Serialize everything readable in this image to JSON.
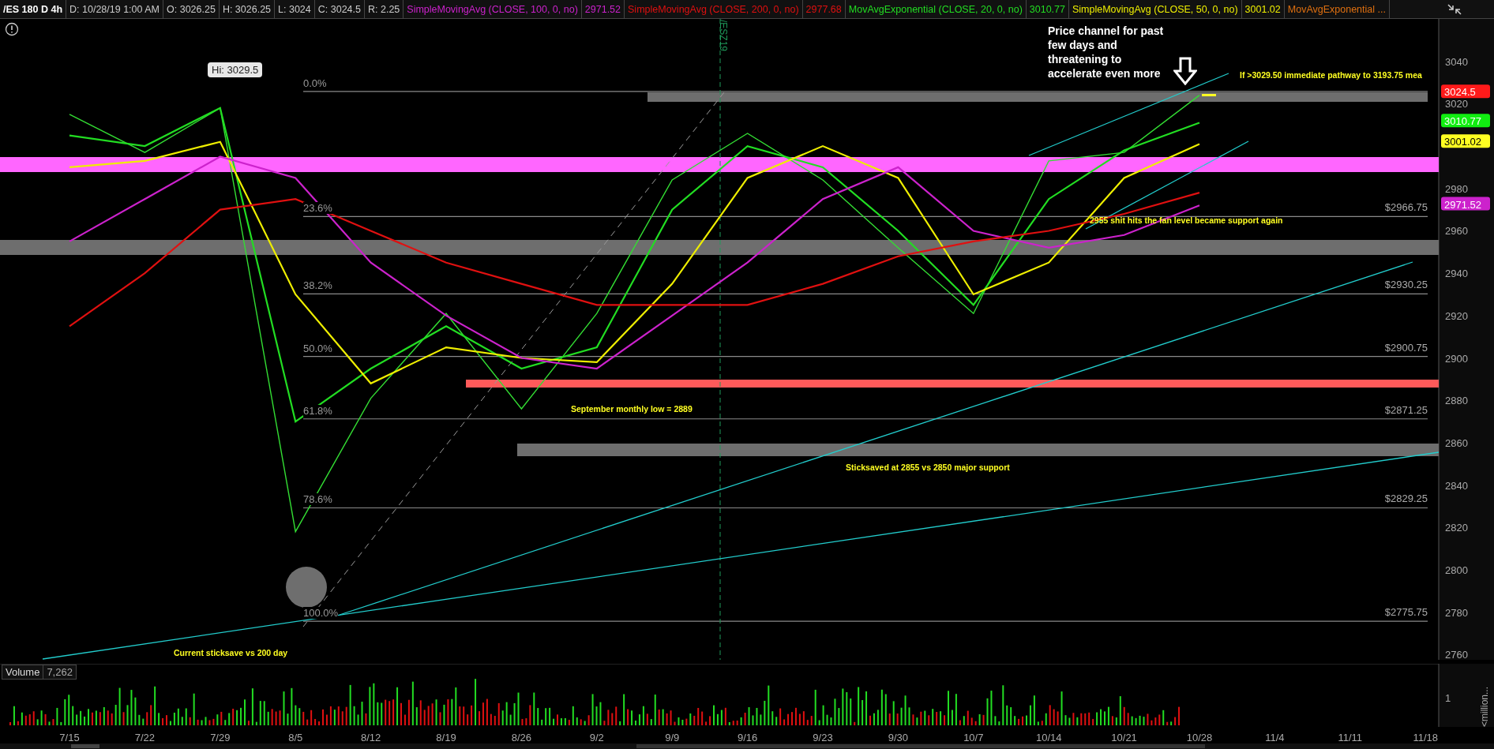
{
  "header": {
    "symbol": "/ES 180 D 4h",
    "fields": [
      "D: 10/28/19 1:00 AM",
      "O: 3026.25",
      "H: 3026.25",
      "L: 3024",
      "C: 3024.5",
      "R: 2.25"
    ],
    "studies": [
      {
        "name": "SimpleMovingAvg (CLOSE, 100, 0, no)",
        "value": "2971.52",
        "color": "#cc22cc"
      },
      {
        "name": "SimpleMovingAvg (CLOSE, 200, 0, no)",
        "value": "2977.68",
        "color": "#e01010"
      },
      {
        "name": "MovAvgExponential (CLOSE, 20, 0, no)",
        "value": "3010.77",
        "color": "#22dd22"
      },
      {
        "name": "SimpleMovingAvg (CLOSE, 50, 0, no)",
        "value": "3001.02",
        "color": "#eeee00"
      },
      {
        "name": "MovAvgExponential ...",
        "color": "#e07010"
      }
    ]
  },
  "price_chart": {
    "contract_label": "/ESZ19",
    "high_label": "Hi: 3029.5",
    "chart_data": {
      "type": "line",
      "x": [
        "7/15",
        "7/22",
        "7/29",
        "8/5",
        "8/12",
        "8/19",
        "8/26",
        "9/2",
        "9/9",
        "9/16",
        "9/23",
        "9/30",
        "10/7",
        "10/14",
        "10/21",
        "10/28",
        "11/4",
        "11/11",
        "11/18"
      ],
      "series": [
        {
          "color": "#33dd33",
          "values": [
            3015,
            2997,
            3018,
            2818,
            2881,
            2921,
            2876,
            2921,
            2984,
            3006,
            2984,
            2952,
            2921,
            2993,
            2997,
            3024,
            null,
            null,
            null
          ]
        },
        {
          "color": "#22dd22",
          "values": [
            3005,
            3000,
            3018,
            2870,
            2895,
            2915,
            2895,
            2905,
            2970,
            3000,
            2990,
            2960,
            2925,
            2975,
            2998,
            3011,
            null,
            null,
            null
          ]
        },
        {
          "color": "#eeee00",
          "values": [
            2990,
            2993,
            3002,
            2930,
            2888,
            2905,
            2900,
            2898,
            2935,
            2985,
            3000,
            2985,
            2930,
            2945,
            2985,
            3001,
            null,
            null,
            null
          ]
        },
        {
          "color": "#cc22cc",
          "values": [
            2955,
            2975,
            2995,
            2985,
            2945,
            2920,
            2900,
            2895,
            2920,
            2945,
            2975,
            2990,
            2960,
            2952,
            2958,
            2972,
            null,
            null,
            null
          ]
        },
        {
          "color": "#e01010",
          "values": [
            2915,
            2940,
            2970,
            2975,
            2960,
            2945,
            2935,
            2925,
            2925,
            2925,
            2935,
            2948,
            2955,
            2960,
            2968,
            2978,
            null,
            null,
            null
          ]
        }
      ],
      "ylim": [
        2727,
        3060
      ],
      "yticks": [
        3040,
        3020,
        2980,
        2960,
        2940,
        2920,
        2900,
        2880,
        2860,
        2840,
        2820,
        2800,
        2780,
        2760
      ]
    },
    "price_badges": [
      {
        "text": "3024.5",
        "color": "#ff1a1a"
      },
      {
        "text": "3010.77",
        "color": "#11ee11"
      },
      {
        "text": "3001.02",
        "color": "#ffff22"
      },
      {
        "text": "2971.52",
        "color": "#cc22cc"
      }
    ],
    "fib_levels": [
      {
        "percent": "0.0%"
      },
      {
        "percent": "23.6%",
        "price": "$2966.75"
      },
      {
        "percent": "38.2%",
        "price": "$2930.25"
      },
      {
        "percent": "50.0%",
        "price": "$2900.75"
      },
      {
        "percent": "61.8%",
        "price": "$2871.25"
      },
      {
        "percent": "78.6%",
        "price": "$2829.25"
      },
      {
        "percent": "100.0%",
        "price": "$2775.75"
      }
    ],
    "notes": [
      {
        "kind": "callout",
        "text": "Price channel for past few days and threatening to accelerate even more"
      },
      {
        "kind": "note",
        "text": "If >3029.50 immediate pathway to 3193.75 mea"
      },
      {
        "kind": "note",
        "text": "2955 shit hits the fan level became support again"
      },
      {
        "kind": "note",
        "text": "September monthly low = 2889"
      },
      {
        "kind": "note",
        "text": "Sticksaved at 2855 vs 2850 major support"
      },
      {
        "kind": "note",
        "text": "Current sticksave vs 200 day"
      }
    ]
  },
  "volume": {
    "title": "Volume",
    "value": "7,262",
    "axis_tick": "1",
    "axis_unit": "<million..."
  }
}
